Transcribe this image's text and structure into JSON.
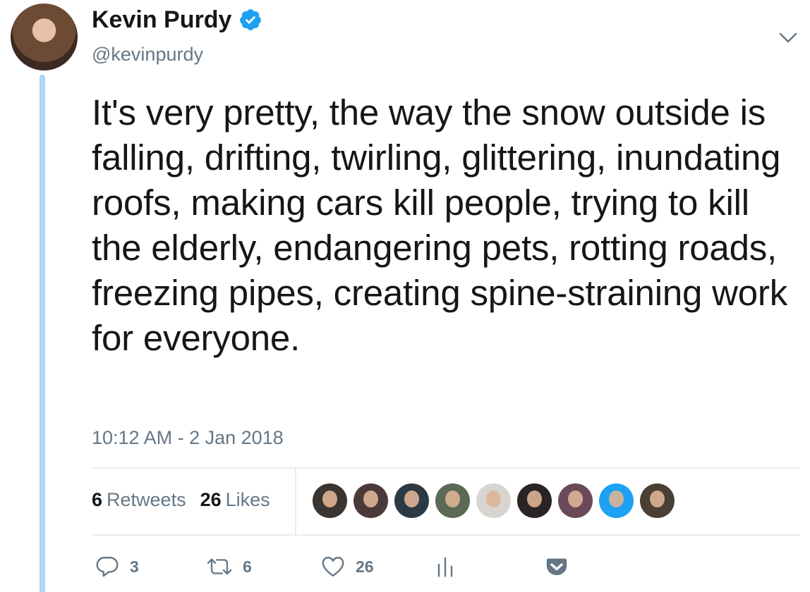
{
  "author": {
    "name": "Kevin Purdy",
    "handle": "@kevinpurdy",
    "verified": true
  },
  "tweet": {
    "text": "It's very pretty, the way the snow outside is falling, drifting, twirling, glittering, inundating roofs, making cars kill people, trying to kill the elderly, endangering pets, rotting roads, freezing pipes, creating spine-straining work for everyone.",
    "timestamp": "10:12 AM - 2 Jan 2018"
  },
  "stats": {
    "retweets_count": "6",
    "retweets_label": "Retweets",
    "likes_count": "26",
    "likes_label": "Likes"
  },
  "liker_avatars": [
    {
      "color": "#3a3530"
    },
    {
      "color": "#4a3a3a"
    },
    {
      "color": "#2c3a45"
    },
    {
      "color": "#5a6a55"
    },
    {
      "color": "#d8d4d0"
    },
    {
      "color": "#2a2424"
    },
    {
      "color": "#6a4a5a"
    },
    {
      "color": "#1da1f2"
    },
    {
      "color": "#4a3f35"
    }
  ],
  "actions": {
    "reply_count": "3",
    "retweet_count": "6",
    "like_count": "26"
  },
  "icons": {
    "verified": "verified-badge-icon",
    "chevron": "chevron-down-icon",
    "reply": "reply-icon",
    "retweet": "retweet-icon",
    "like": "heart-icon",
    "analytics": "analytics-icon",
    "pocket": "pocket-icon"
  },
  "colors": {
    "verified": "#1da1f2",
    "thread_line": "#afd6f4",
    "secondary_text": "#657786",
    "pocket": "#657786"
  }
}
